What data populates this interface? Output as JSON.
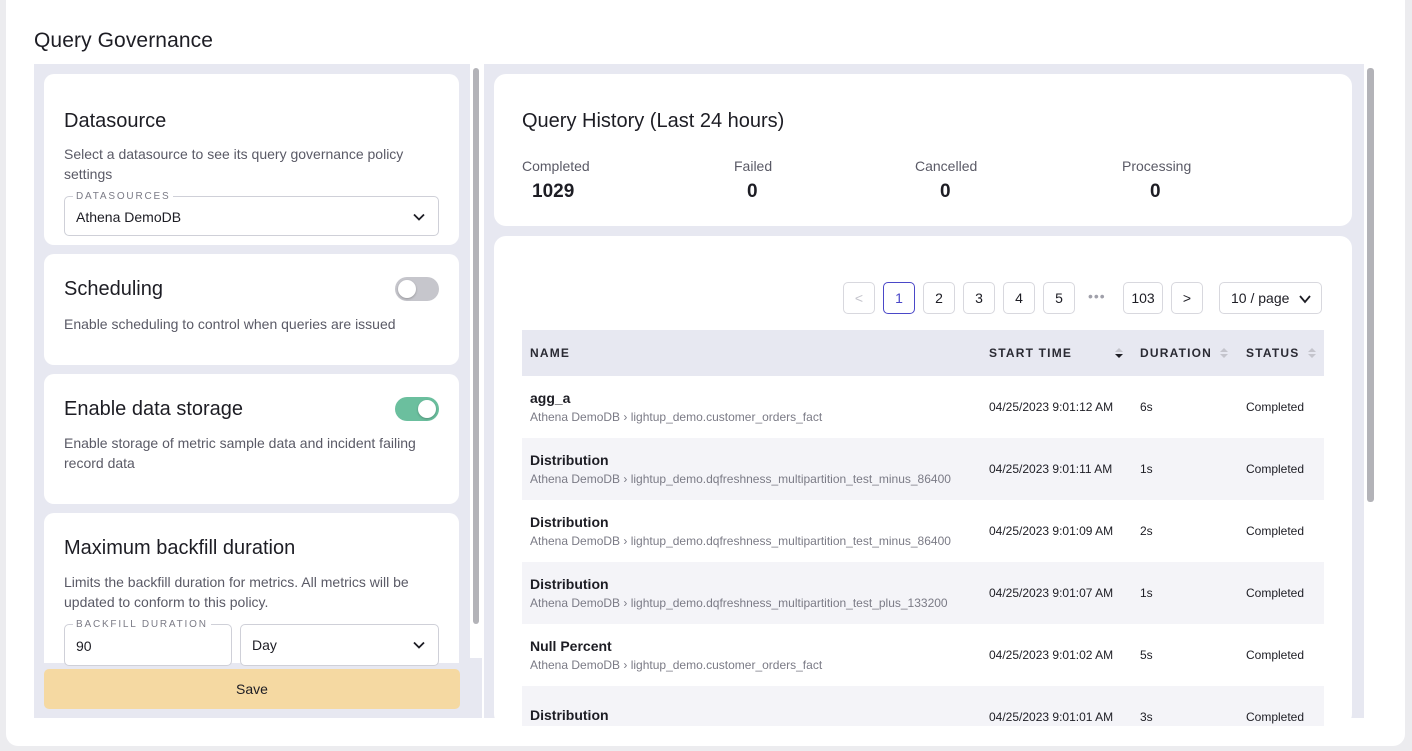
{
  "page": {
    "title": "Query Governance"
  },
  "datasource": {
    "title": "Datasource",
    "description": "Select a datasource to see its query governance policy settings",
    "field_label": "DATASOURCES",
    "selected": "Athena DemoDB"
  },
  "scheduling": {
    "title": "Scheduling",
    "description": "Enable scheduling to control when queries are issued",
    "enabled": false
  },
  "data_storage": {
    "title": "Enable data storage",
    "description": "Enable storage of metric sample data and incident failing record data",
    "enabled": true
  },
  "backfill": {
    "title": "Maximum backfill duration",
    "description": "Limits the backfill duration for metrics. All metrics will be updated to conform to this policy.",
    "field_label": "BACKFILL DURATION",
    "value": "90",
    "unit": "Day"
  },
  "save_label": "Save",
  "history": {
    "title": "Query History (Last 24 hours)",
    "stats": [
      {
        "label": "Completed",
        "value": "1029"
      },
      {
        "label": "Failed",
        "value": "0"
      },
      {
        "label": "Cancelled",
        "value": "0"
      },
      {
        "label": "Processing",
        "value": "0"
      }
    ]
  },
  "pagination": {
    "prev": "<",
    "next": ">",
    "pages": [
      "1",
      "2",
      "3",
      "4",
      "5"
    ],
    "ellipsis": "•••",
    "last_page": "103",
    "current": "1",
    "page_size": "10 / page"
  },
  "table": {
    "columns": [
      "NAME",
      "START TIME",
      "DURATION",
      "STATUS"
    ],
    "rows": [
      {
        "name": "agg_a",
        "path": "Athena DemoDB › lightup_demo.customer_orders_fact",
        "start": "04/25/2023 9:01:12 AM",
        "duration": "6s",
        "status": "Completed"
      },
      {
        "name": "Distribution",
        "path": "Athena DemoDB › lightup_demo.dqfreshness_multipartition_test_minus_86400",
        "start": "04/25/2023 9:01:11 AM",
        "duration": "1s",
        "status": "Completed"
      },
      {
        "name": "Distribution",
        "path": "Athena DemoDB › lightup_demo.dqfreshness_multipartition_test_minus_86400",
        "start": "04/25/2023 9:01:09 AM",
        "duration": "2s",
        "status": "Completed"
      },
      {
        "name": "Distribution",
        "path": "Athena DemoDB › lightup_demo.dqfreshness_multipartition_test_plus_133200",
        "start": "04/25/2023 9:01:07 AM",
        "duration": "1s",
        "status": "Completed"
      },
      {
        "name": "Null Percent",
        "path": "Athena DemoDB › lightup_demo.customer_orders_fact",
        "start": "04/25/2023 9:01:02 AM",
        "duration": "5s",
        "status": "Completed"
      },
      {
        "name": "Distribution",
        "path": "",
        "start": "04/25/2023 9:01:01 AM",
        "duration": "3s",
        "status": "Completed"
      }
    ]
  },
  "colors": {
    "accent": "#4a47c8",
    "toggle_on": "#6bbf9e",
    "toggle_off": "#c6c6cc",
    "save_button": "#f5d9a2",
    "panel_bg": "#e7e8f1"
  }
}
